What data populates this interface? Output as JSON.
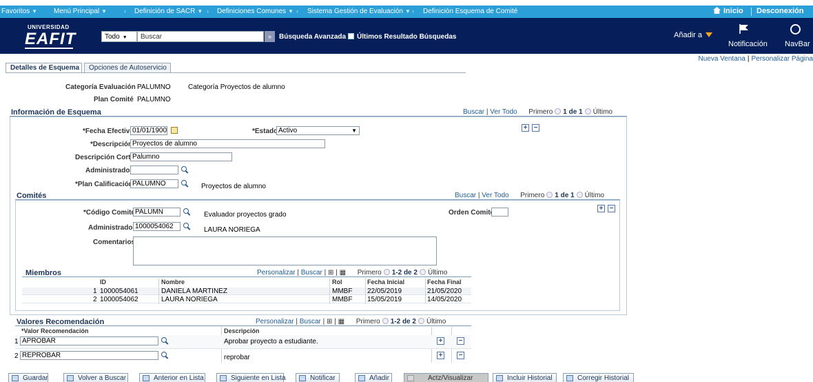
{
  "topbar": {
    "favorites": "Favoritos",
    "main_menu": "Menú Principal",
    "crumb1": "Definición de SACR",
    "crumb2": "Definiciones Comunes",
    "crumb3": "Sistema Gestión de Evaluación",
    "crumb4": "Definición Esquema de Comité",
    "home": "Inicio",
    "logout": "Desconexión"
  },
  "header": {
    "logo_top": "UNIVERSIDAD",
    "logo_main": "EAFIT",
    "search_scope": "Todo",
    "search_placeholder": "Buscar",
    "advanced": "Búsqueda Avanzada",
    "last_results": "Últimos Resultado Búsquedas",
    "add_to": "Añadir a",
    "notification": "Notificación",
    "navbar": "NavBar"
  },
  "links": {
    "new_window": "Nueva Ventana",
    "personalize": "Personalizar Página"
  },
  "tabs": [
    {
      "label": "Detalles de Esquema"
    },
    {
      "label": "Opciones de Autoservicio"
    }
  ],
  "summary": {
    "cat_label": "Categoría Evaluación",
    "cat_value": "PALUMNO",
    "cat_desc": "Categoría Proyectos de alumno",
    "plan_label": "Plan Comité",
    "plan_value": "PALUMNO"
  },
  "info": {
    "title": "Información de Esquema",
    "nav_search": "Buscar",
    "nav_viewall": "Ver Todo",
    "nav_first": "Primero",
    "nav_count": "1 de 1",
    "nav_last": "Último",
    "date_label": "*Fecha Efectiva",
    "date_value": "01/01/1900",
    "status_label": "*Estado",
    "status_value": "Activo",
    "desc_label": "*Descripción",
    "desc_value": "Proyectos de alumno",
    "short_label": "Descripción Corta",
    "short_value": "Palumno",
    "admin_label": "Administrador",
    "admin_value": "",
    "plan_label": "*Plan Calificación",
    "plan_value": "PALUMNO",
    "plan_desc": "Proyectos de alumno"
  },
  "committees": {
    "title": "Comités",
    "nav_search": "Buscar",
    "nav_viewall": "Ver Todo",
    "nav_first": "Primero",
    "nav_count": "1 de 1",
    "nav_last": "Último",
    "code_label": "*Código Comité",
    "code_value": "PALUMN",
    "code_desc": "Evaluador proyectos grado",
    "order_label": "Orden Comité",
    "order_value": "",
    "admin_label": "Administrador",
    "admin_value": "1000054062",
    "admin_name": "LAURA NORIEGA",
    "comments_label": "Comentarios"
  },
  "members": {
    "title": "Miembros",
    "personalize": "Personalizar",
    "search": "Buscar",
    "nav_first": "Primero",
    "nav_count": "1-2 de 2",
    "nav_last": "Último",
    "headers": [
      "ID",
      "Nombre",
      "Rol",
      "Fecha Inicial",
      "Fecha Final"
    ],
    "rows": [
      {
        "n": "1",
        "id": "1000054061",
        "name": "DANIELA MARTINEZ",
        "role": "MMBF",
        "start": "22/05/2019",
        "end": "21/05/2020"
      },
      {
        "n": "2",
        "id": "1000054062",
        "name": "LAURA NORIEGA",
        "role": "MMBF",
        "start": "15/05/2019",
        "end": "14/05/2020"
      }
    ]
  },
  "recs": {
    "title": "Valores Recomendación",
    "personalize": "Personalizar",
    "search": "Buscar",
    "nav_first": "Primero",
    "nav_count": "1-2 de 2",
    "nav_last": "Último",
    "headers": [
      "*Valor Recomendación",
      "Descripción"
    ],
    "rows": [
      {
        "n": "1",
        "value": "APROBAR",
        "desc": "Aprobar proyecto a estudiante."
      },
      {
        "n": "2",
        "value": "REPROBAR",
        "desc": "reprobar"
      }
    ]
  },
  "toolbar": {
    "save": "Guardar",
    "back": "Volver a Buscar",
    "prev": "Anterior en Lista",
    "next": "Siguiente en Lista",
    "notify": "Notificar",
    "add": "Añadir",
    "update": "Actz/Visualizar",
    "include": "Incluir Historial",
    "correct": "Corregir Historial"
  }
}
